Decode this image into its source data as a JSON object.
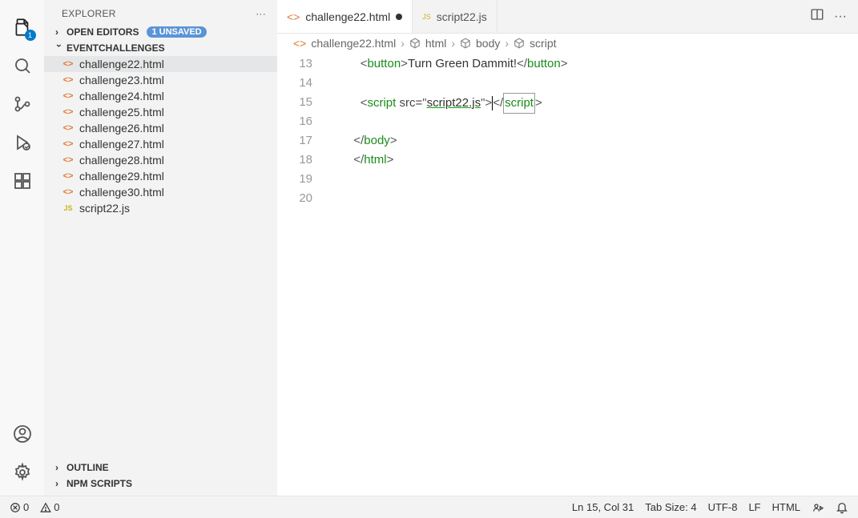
{
  "sidebar": {
    "title": "EXPLORER",
    "openEditors": {
      "label": "OPEN EDITORS",
      "badge": "1 UNSAVED"
    },
    "folder": "EVENTCHALLENGES",
    "files": [
      {
        "name": "challenge22.html",
        "type": "html",
        "selected": true
      },
      {
        "name": "challenge23.html",
        "type": "html"
      },
      {
        "name": "challenge24.html",
        "type": "html"
      },
      {
        "name": "challenge25.html",
        "type": "html"
      },
      {
        "name": "challenge26.html",
        "type": "html"
      },
      {
        "name": "challenge27.html",
        "type": "html"
      },
      {
        "name": "challenge28.html",
        "type": "html"
      },
      {
        "name": "challenge29.html",
        "type": "html"
      },
      {
        "name": "challenge30.html",
        "type": "html"
      },
      {
        "name": "script22.js",
        "type": "js"
      }
    ],
    "outline": "OUTLINE",
    "npm": "NPM SCRIPTS"
  },
  "activityBadge": "1",
  "tabs": [
    {
      "name": "challenge22.html",
      "type": "html",
      "active": true,
      "dirty": true
    },
    {
      "name": "script22.js",
      "type": "js",
      "active": false,
      "dirty": false
    }
  ],
  "breadcrumbs": {
    "file": "challenge22.html",
    "path": [
      "html",
      "body",
      "script"
    ]
  },
  "code": {
    "startLine": 13,
    "lines": [
      {
        "n": 13,
        "indent": 5,
        "segs": [
          [
            "<",
            "p"
          ],
          [
            "button",
            "t"
          ],
          [
            ">",
            "p"
          ],
          [
            "Turn Green Dammit!",
            "x"
          ],
          [
            "</",
            "p"
          ],
          [
            "button",
            "t"
          ],
          [
            ">",
            "p"
          ]
        ]
      },
      {
        "n": 14,
        "indent": 0,
        "segs": []
      },
      {
        "n": 15,
        "indent": 5,
        "segs": [
          [
            "<",
            "p"
          ],
          [
            "script",
            "t"
          ],
          [
            " src=",
            "a"
          ],
          [
            "\"",
            "p"
          ],
          [
            "script22.js",
            "s"
          ],
          [
            "\"",
            "p"
          ],
          [
            ">",
            "p"
          ],
          [
            "",
            "cur"
          ],
          [
            "</",
            "p"
          ],
          [
            "script",
            "tsel"
          ],
          [
            ">",
            "p"
          ]
        ]
      },
      {
        "n": 16,
        "indent": 0,
        "segs": []
      },
      {
        "n": 17,
        "indent": 4,
        "segs": [
          [
            "</",
            "p"
          ],
          [
            "body",
            "t"
          ],
          [
            ">",
            "p"
          ]
        ]
      },
      {
        "n": 18,
        "indent": 4,
        "segs": [
          [
            "</",
            "p"
          ],
          [
            "html",
            "t"
          ],
          [
            ">",
            "p"
          ]
        ]
      },
      {
        "n": 19,
        "indent": 0,
        "segs": []
      },
      {
        "n": 20,
        "indent": 0,
        "segs": []
      }
    ]
  },
  "status": {
    "errors": "0",
    "warnings": "0",
    "position": "Ln 15, Col 31",
    "tabSize": "Tab Size: 4",
    "encoding": "UTF-8",
    "eol": "LF",
    "language": "HTML"
  }
}
